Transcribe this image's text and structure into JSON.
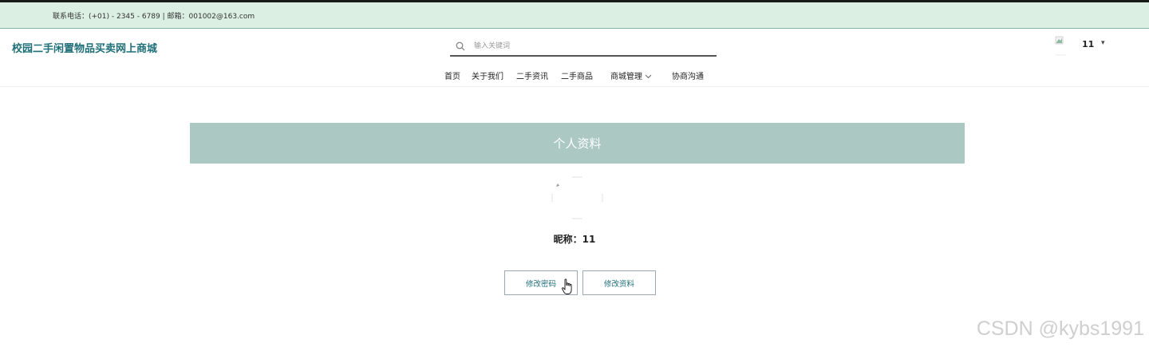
{
  "topbar": {
    "contact_text": "联系电话：(+01) - 2345 - 6789 | 邮箱：001002@163.com"
  },
  "header": {
    "site_title": "校园二手闲置物品买卖网上商城",
    "search_placeholder": "输入关键词",
    "search_icon": "search-icon",
    "nav": {
      "home": "首页",
      "about": "关于我们",
      "news": "二手资讯",
      "goods": "二手商品",
      "mall_manage": "商城管理",
      "chat": "协商沟通"
    },
    "user": {
      "name": "11",
      "caret": "▾"
    }
  },
  "profile": {
    "banner_title": "个人资料",
    "nickname_label": "昵称：",
    "nickname_value": "11",
    "buttons": {
      "change_password": "修改密码",
      "edit_profile": "修改资料"
    }
  },
  "watermark": "CSDN @kybs1991",
  "colors": {
    "topbar_bg": "#dcefe3",
    "brand": "#1f6f78",
    "banner_bg": "#abc8c3"
  }
}
